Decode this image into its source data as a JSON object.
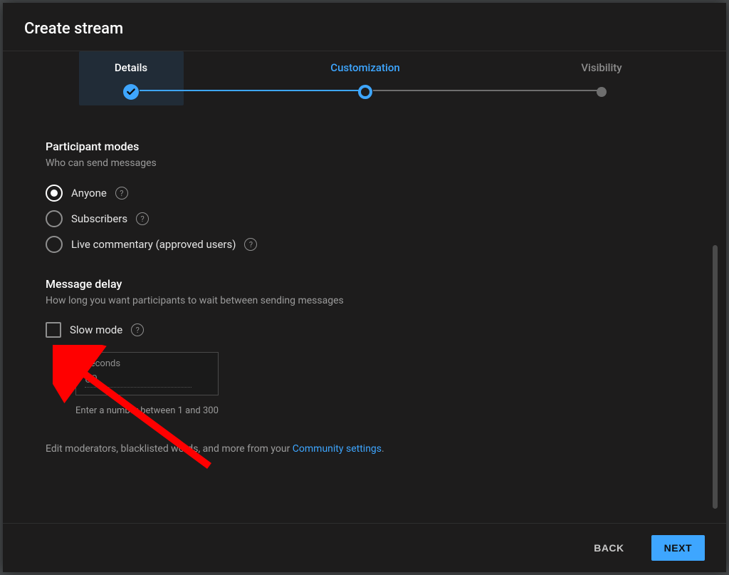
{
  "title": "Create stream",
  "stepper": {
    "details": "Details",
    "customization": "Customization",
    "visibility": "Visibility"
  },
  "participant": {
    "title": "Participant modes",
    "subtitle": "Who can send messages",
    "options": {
      "anyone": "Anyone",
      "subscribers": "Subscribers",
      "live_commentary": "Live commentary (approved users)"
    }
  },
  "messageDelay": {
    "title": "Message delay",
    "subtitle": "How long you want participants to wait between sending messages",
    "slowMode": "Slow mode",
    "secondsLabel": "Seconds",
    "secondsValue": "60",
    "helper": "Enter a number between 1 and 300"
  },
  "editLine": {
    "prefix": "Edit moderators, blacklisted words, and more from your ",
    "link": "Community settings",
    "suffix": "."
  },
  "footer": {
    "back": "BACK",
    "next": "NEXT"
  }
}
